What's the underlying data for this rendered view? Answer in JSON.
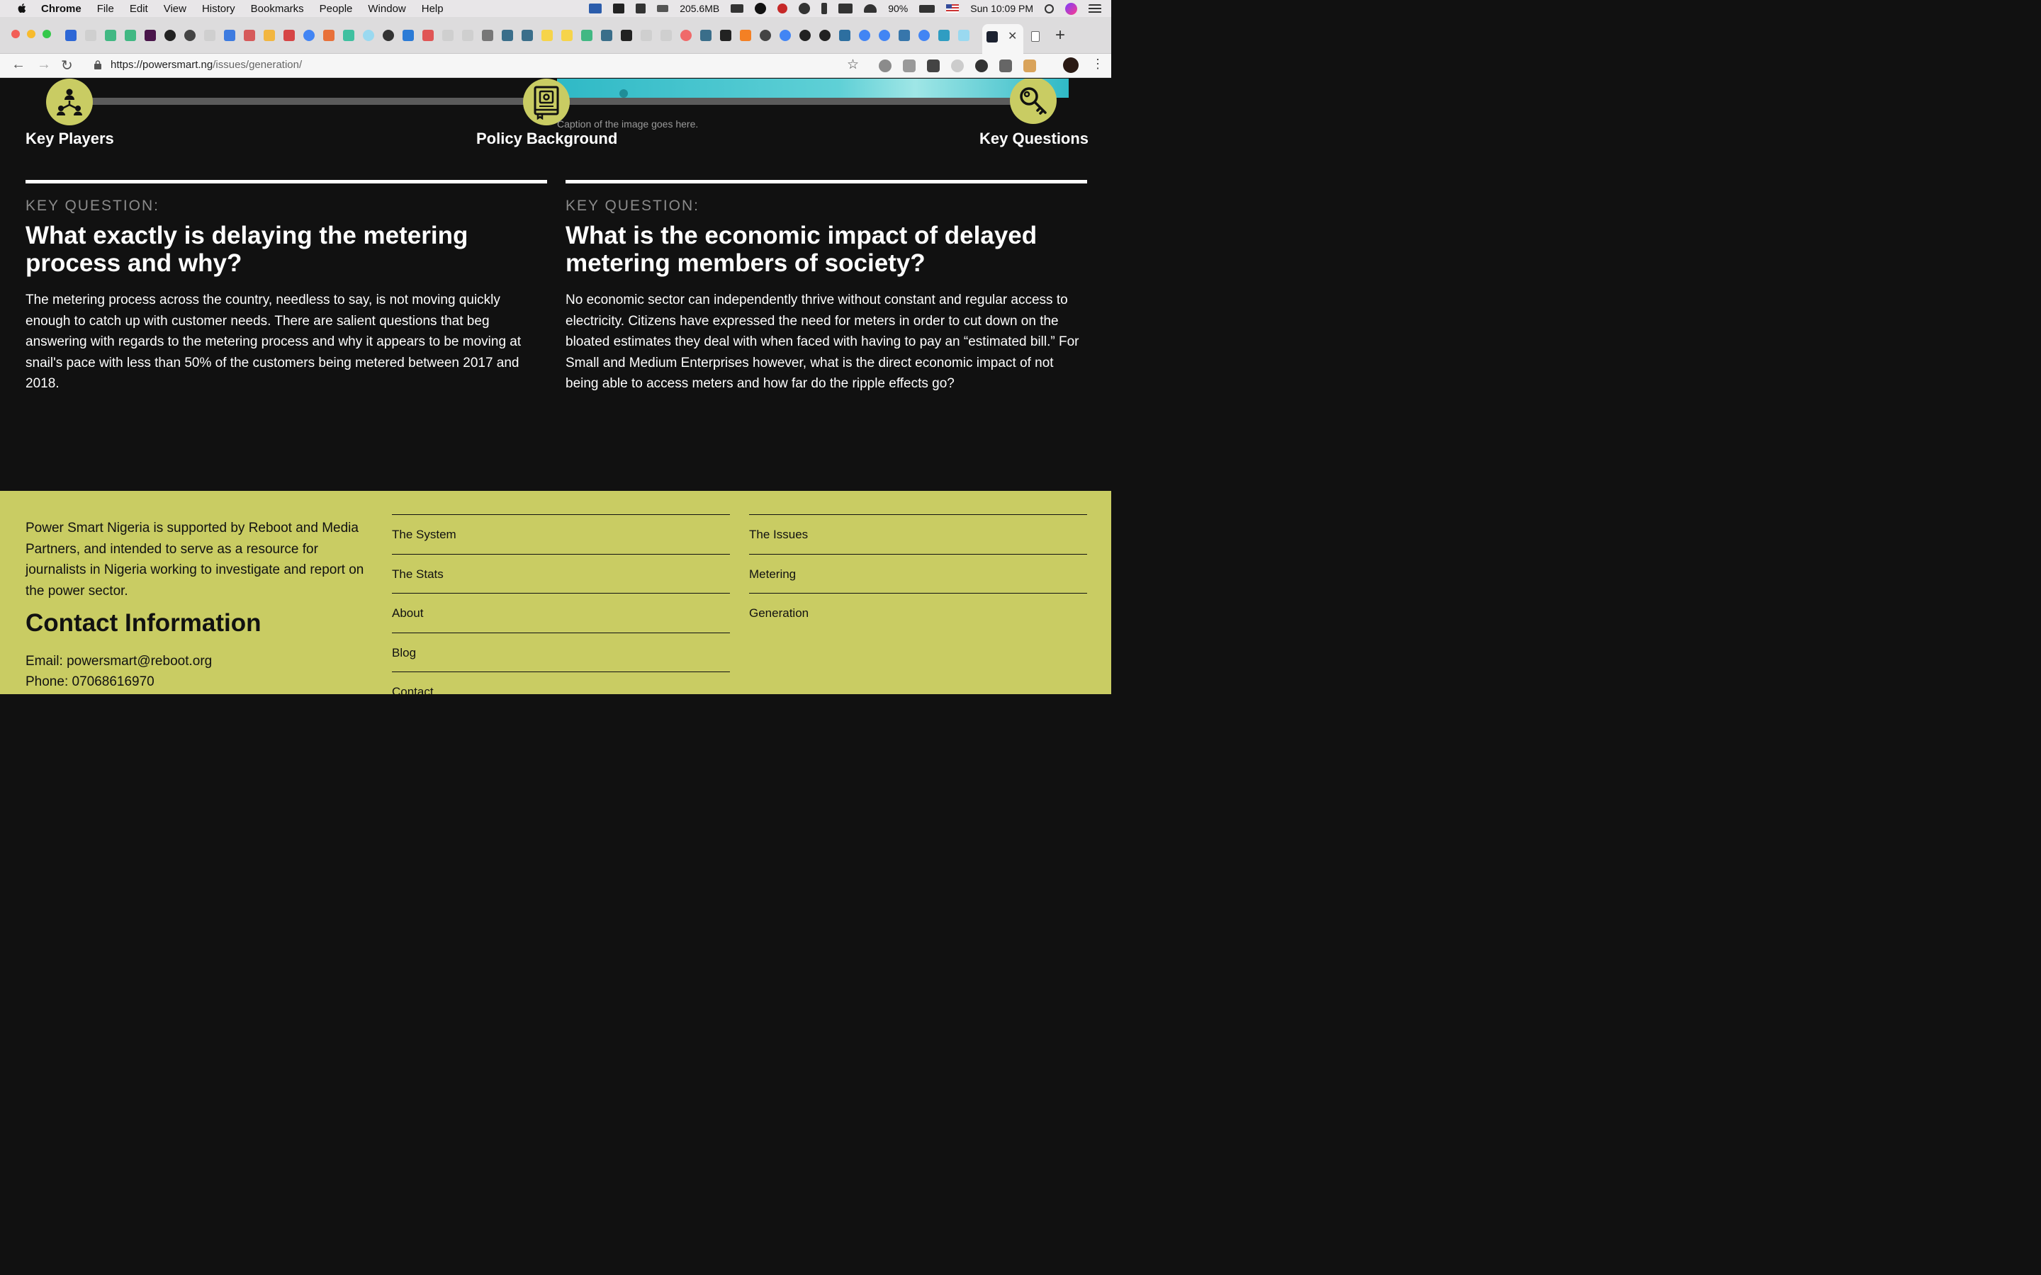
{
  "menubar": {
    "app": "Chrome",
    "items": [
      "File",
      "Edit",
      "View",
      "History",
      "Bookmarks",
      "People",
      "Window",
      "Help"
    ],
    "memory": "205.6MB",
    "battery": "90%",
    "clock": "Sun 10:09 PM"
  },
  "tabs": {
    "active_tab_favicon": "swarm-icon"
  },
  "toolbar": {
    "url_host": "https://powersmart.ng",
    "url_path": "/issues/generation/"
  },
  "timeline": {
    "caption": "Caption of the image goes here.",
    "steps": [
      {
        "label": "Key Players",
        "icon": "network-people-icon"
      },
      {
        "label": "Policy Background",
        "icon": "book-icon"
      },
      {
        "label": "Key Questions",
        "icon": "key-magnifier-icon"
      }
    ]
  },
  "questions": [
    {
      "label": "KEY QUESTION:",
      "title": "What exactly is delaying the metering process and why?",
      "body": "The metering process across the country, needless to say, is not moving quickly enough to catch up with customer needs. There are salient questions that beg answering with regards to the metering process and why it appears to be moving at snail's pace with less than 50% of the customers being metered between 2017 and 2018."
    },
    {
      "label": "KEY QUESTION:",
      "title": "What is the economic impact of delayed metering members of society?",
      "body": "No economic sector can independently thrive without constant and regular access to electricity. Citizens have expressed the need for meters in order to cut down on the bloated estimates they deal with when faced with having to pay an “estimated bill.” For Small and Medium Enterprises however, what is the direct economic impact of not being able to access meters and how far do the ripple effects go?"
    }
  ],
  "footer": {
    "about": "Power Smart Nigeria is supported by Reboot and Media Partners, and intended to serve as a resource for journalists in Nigeria working to investigate and report on the power sector.",
    "contact_heading": "Contact Information",
    "email": "Email: powersmart@reboot.org",
    "phone": "Phone: 07068616970",
    "links_col1": [
      "The System",
      "The Stats",
      "About",
      "Blog",
      "Contact"
    ],
    "links_col2": [
      "The Issues",
      "Metering",
      "Generation"
    ]
  },
  "colors": {
    "accent": "#c9cc63",
    "page_bg": "#111111",
    "timeline_bar": "#5b5b5b",
    "muted_text": "#8a8a8a"
  }
}
